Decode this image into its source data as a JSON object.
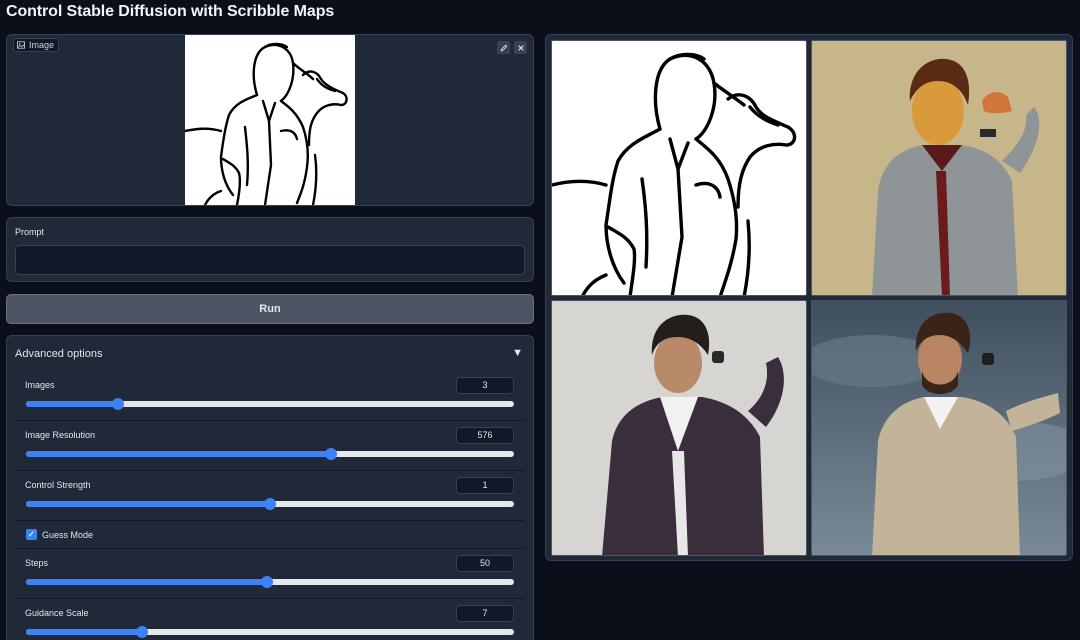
{
  "app": {
    "title": "Control Stable Diffusion with Scribble Maps"
  },
  "image_input": {
    "label": "Image",
    "edit_icon": "pencil-icon",
    "clear_icon": "close-icon"
  },
  "prompt": {
    "label": "Prompt",
    "value": ""
  },
  "run": {
    "label": "Run"
  },
  "advanced": {
    "title": "Advanced options",
    "toggle_icon": "triangle-down-icon",
    "controls": [
      {
        "label": "Images",
        "value": "3",
        "fraction": 0.188
      },
      {
        "label": "Image Resolution",
        "value": "576",
        "fraction": 0.625
      },
      {
        "label": "Control Strength",
        "value": "1",
        "fraction": 0.5
      },
      {
        "label": "Steps",
        "value": "50",
        "fraction": 0.494
      },
      {
        "label": "Guidance Scale",
        "value": "7",
        "fraction": 0.237
      }
    ],
    "guess_mode": {
      "label": "Guess Mode",
      "checked": true
    }
  },
  "colors": {
    "accent": "#3b82f6",
    "background": "#0b0f19",
    "panel": "#1f2937"
  }
}
